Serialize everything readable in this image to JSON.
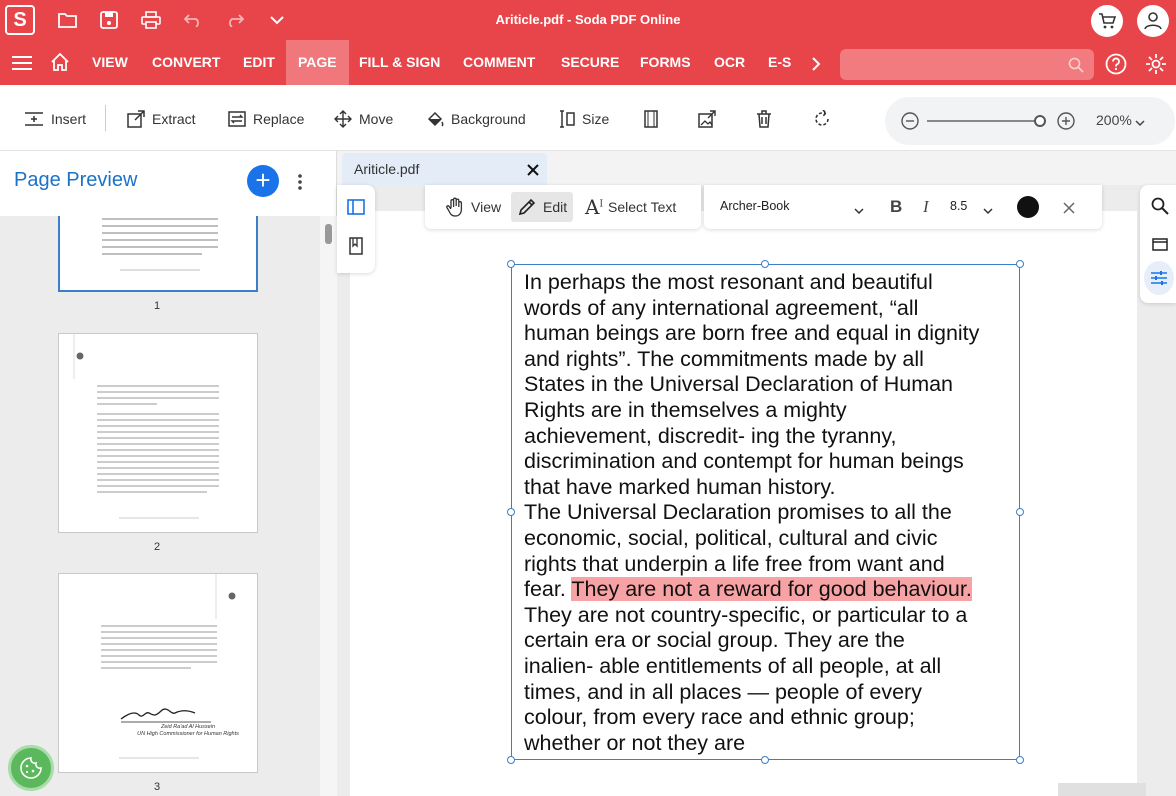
{
  "app": {
    "title": "Ariticle.pdf - Soda PDF Online",
    "logo_letter": "S"
  },
  "nav": {
    "tabs": [
      "VIEW",
      "CONVERT",
      "EDIT",
      "PAGE",
      "FILL & SIGN",
      "COMMENT",
      "SECURE",
      "FORMS",
      "OCR",
      "E-S"
    ],
    "active": "PAGE"
  },
  "toolbar": {
    "insert": "Insert",
    "extract": "Extract",
    "replace": "Replace",
    "move": "Move",
    "background": "Background",
    "size": "Size",
    "zoom": "200%"
  },
  "left_panel": {
    "title": "Page Preview",
    "thumbs": [
      "1",
      "2",
      "3"
    ],
    "page3_signature": "Zeid Ra'ad Al Hussein",
    "page3_role": "UN High Commissioner for Human Rights"
  },
  "doc": {
    "tab_name": "Ariticle.pdf",
    "mode_view": "View",
    "mode_edit": "Edit",
    "mode_select": "Select Text",
    "font": "Archer-Book",
    "font_size": "8.5",
    "text_before": "In perhaps the most resonant and beautiful\nwords of any international agreement, “all\nhuman beings are born free and equal in dignity\n and rights”. The commitments made by all\nStates in the Universal Declaration of Human\nRights are in themselves a mighty\nachievement, discredit- ing the tyranny,\ndiscrimination and contempt for human beings\nthat have marked human history.\nThe Universal Declaration promises to all the\neconomic, social, political, cultural and civic\nrights that underpin a life free from want and\nfear. ",
    "text_highlight": "They are not a reward for good behaviour.",
    "text_after": "\n They are not country-specific, or particular to a\ncertain era or social group. They are the\ninalien- able entitlements of all people, at all\ntimes, and in all places — people of every\ncolour, from every race and ethnic group;\nwhether or not they are"
  },
  "colors": {
    "brand": "#e8454a",
    "active_tab": "#f0777b",
    "accent": "#1a73e8",
    "highlight": "#f7a3a6"
  }
}
